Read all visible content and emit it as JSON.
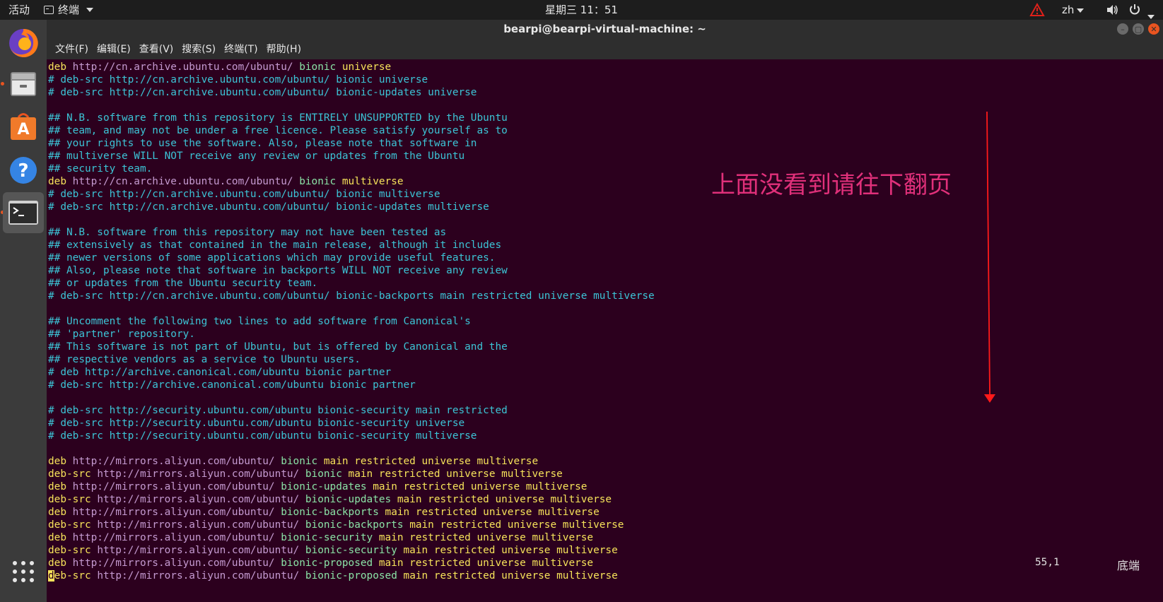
{
  "topbar": {
    "activities": "活动",
    "app_name": "终端",
    "clock": "星期三 11：51",
    "lang": "zh"
  },
  "window": {
    "title": "bearpi@bearpi-virtual-machine: ~",
    "menu": [
      "文件(F)",
      "编辑(E)",
      "查看(V)",
      "搜索(S)",
      "终端(T)",
      "帮助(H)"
    ]
  },
  "dock": {
    "items": [
      "firefox-icon",
      "files-icon",
      "software-center-icon",
      "help-icon",
      "terminal-icon"
    ],
    "show_apps": "show-applications-icon"
  },
  "terminal": {
    "lines": [
      [
        [
          "d",
          "deb "
        ],
        [
          "u",
          "http://cn.archive.ubuntu.com/ubuntu/ "
        ],
        [
          "b",
          "bionic "
        ],
        [
          "k",
          "universe"
        ]
      ],
      [
        [
          "c",
          "# deb-src http://cn.archive.ubuntu.com/ubuntu/ bionic universe"
        ]
      ],
      [
        [
          "c",
          "# deb-src http://cn.archive.ubuntu.com/ubuntu/ bionic-updates universe"
        ]
      ],
      [],
      [
        [
          "c",
          "## N.B. software from this repository is ENTIRELY UNSUPPORTED by the Ubuntu"
        ]
      ],
      [
        [
          "c",
          "## team, and may not be under a free licence. Please satisfy yourself as to"
        ]
      ],
      [
        [
          "c",
          "## your rights to use the software. Also, please note that software in"
        ]
      ],
      [
        [
          "c",
          "## multiverse WILL NOT receive any review or updates from the Ubuntu"
        ]
      ],
      [
        [
          "c",
          "## security team."
        ]
      ],
      [
        [
          "d",
          "deb "
        ],
        [
          "u",
          "http://cn.archive.ubuntu.com/ubuntu/ "
        ],
        [
          "b",
          "bionic "
        ],
        [
          "k",
          "multiverse"
        ]
      ],
      [
        [
          "c",
          "# deb-src http://cn.archive.ubuntu.com/ubuntu/ bionic multiverse"
        ]
      ],
      [
        [
          "c",
          "# deb-src http://cn.archive.ubuntu.com/ubuntu/ bionic-updates multiverse"
        ]
      ],
      [],
      [
        [
          "c",
          "## N.B. software from this repository may not have been tested as"
        ]
      ],
      [
        [
          "c",
          "## extensively as that contained in the main release, although it includes"
        ]
      ],
      [
        [
          "c",
          "## newer versions of some applications which may provide useful features."
        ]
      ],
      [
        [
          "c",
          "## Also, please note that software in backports WILL NOT receive any review"
        ]
      ],
      [
        [
          "c",
          "## or updates from the Ubuntu security team."
        ]
      ],
      [
        [
          "c",
          "# deb-src http://cn.archive.ubuntu.com/ubuntu/ bionic-backports main restricted universe multiverse"
        ]
      ],
      [],
      [
        [
          "c",
          "## Uncomment the following two lines to add software from Canonical's"
        ]
      ],
      [
        [
          "c",
          "## 'partner' repository."
        ]
      ],
      [
        [
          "c",
          "## This software is not part of Ubuntu, but is offered by Canonical and the"
        ]
      ],
      [
        [
          "c",
          "## respective vendors as a service to Ubuntu users."
        ]
      ],
      [
        [
          "c",
          "# deb http://archive.canonical.com/ubuntu bionic partner"
        ]
      ],
      [
        [
          "c",
          "# deb-src http://archive.canonical.com/ubuntu bionic partner"
        ]
      ],
      [],
      [
        [
          "c",
          "# deb-src http://security.ubuntu.com/ubuntu bionic-security main restricted"
        ]
      ],
      [
        [
          "c",
          "# deb-src http://security.ubuntu.com/ubuntu bionic-security universe"
        ]
      ],
      [
        [
          "c",
          "# deb-src http://security.ubuntu.com/ubuntu bionic-security multiverse"
        ]
      ],
      [],
      [
        [
          "d",
          "deb "
        ],
        [
          "u",
          "http://mirrors.aliyun.com/ubuntu/ "
        ],
        [
          "b",
          "bionic "
        ],
        [
          "k",
          "main restricted universe multiverse"
        ]
      ],
      [
        [
          "d",
          "deb-src "
        ],
        [
          "u",
          "http://mirrors.aliyun.com/ubuntu/ "
        ],
        [
          "b",
          "bionic "
        ],
        [
          "k",
          "main restricted universe multiverse"
        ]
      ],
      [
        [
          "d",
          "deb "
        ],
        [
          "u",
          "http://mirrors.aliyun.com/ubuntu/ "
        ],
        [
          "b",
          "bionic-updates "
        ],
        [
          "k",
          "main restricted universe multiverse"
        ]
      ],
      [
        [
          "d",
          "deb-src "
        ],
        [
          "u",
          "http://mirrors.aliyun.com/ubuntu/ "
        ],
        [
          "b",
          "bionic-updates "
        ],
        [
          "k",
          "main restricted universe multiverse"
        ]
      ],
      [
        [
          "d",
          "deb "
        ],
        [
          "u",
          "http://mirrors.aliyun.com/ubuntu/ "
        ],
        [
          "b",
          "bionic-backports "
        ],
        [
          "k",
          "main restricted universe multiverse"
        ]
      ],
      [
        [
          "d",
          "deb-src "
        ],
        [
          "u",
          "http://mirrors.aliyun.com/ubuntu/ "
        ],
        [
          "b",
          "bionic-backports "
        ],
        [
          "k",
          "main restricted universe multiverse"
        ]
      ],
      [
        [
          "d",
          "deb "
        ],
        [
          "u",
          "http://mirrors.aliyun.com/ubuntu/ "
        ],
        [
          "b",
          "bionic-security "
        ],
        [
          "k",
          "main restricted universe multiverse"
        ]
      ],
      [
        [
          "d",
          "deb-src "
        ],
        [
          "u",
          "http://mirrors.aliyun.com/ubuntu/ "
        ],
        [
          "b",
          "bionic-security "
        ],
        [
          "k",
          "main restricted universe multiverse"
        ]
      ],
      [
        [
          "d",
          "deb "
        ],
        [
          "u",
          "http://mirrors.aliyun.com/ubuntu/ "
        ],
        [
          "b",
          "bionic-proposed "
        ],
        [
          "k",
          "main restricted universe multiverse"
        ]
      ],
      [
        [
          "cur",
          "d"
        ],
        [
          "d",
          "eb-src "
        ],
        [
          "u",
          "http://mirrors.aliyun.com/ubuntu/ "
        ],
        [
          "b",
          "bionic-proposed "
        ],
        [
          "k",
          "main restricted universe multiverse"
        ]
      ]
    ],
    "status_position": "55,1",
    "status_scroll": "底端"
  },
  "annotation": {
    "text": "上面没看到请往下翻页",
    "color": "#e0307a",
    "arrow_color": "#ff1a1a"
  },
  "colors": {
    "terminal_bg": "#2c001e",
    "comment": "#3cc4d6",
    "keyword": "#f6e35a",
    "url": "#c49ad0",
    "release": "#8ae3a6",
    "accent": "#e95420"
  }
}
